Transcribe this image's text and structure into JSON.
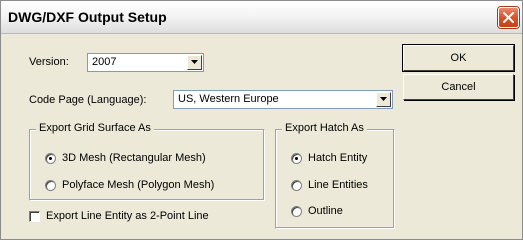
{
  "window": {
    "title": "DWG/DXF Output Setup"
  },
  "version": {
    "label": "Version:",
    "value": "2007"
  },
  "code_page": {
    "label": "Code Page (Language):",
    "value": "US, Western Europe"
  },
  "buttons": {
    "ok": "OK",
    "cancel": "Cancel"
  },
  "grid_surface": {
    "title": "Export Grid Surface As",
    "options": [
      {
        "label": "3D Mesh (Rectangular Mesh)",
        "selected": true
      },
      {
        "label": "Polyface Mesh (Polygon Mesh)",
        "selected": false
      }
    ]
  },
  "hatch": {
    "title": "Export Hatch As",
    "options": [
      {
        "label": "Hatch Entity",
        "selected": true
      },
      {
        "label": "Line Entities",
        "selected": false
      },
      {
        "label": "Outline",
        "selected": false
      }
    ]
  },
  "line_entity_checkbox": {
    "label": "Export Line Entity as 2-Point Line",
    "checked": false
  },
  "colors": {
    "dialog_bg": "#ece9d8",
    "close_button": "#d9532c",
    "field_border": "#7f9db9"
  }
}
